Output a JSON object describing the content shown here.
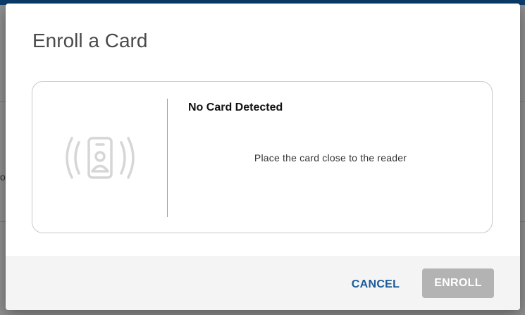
{
  "background": {
    "fragment_text": "o"
  },
  "dialog": {
    "title": "Enroll a Card",
    "status": {
      "title": "No Card Detected",
      "message": "Place the card close to the reader"
    },
    "buttons": {
      "cancel_label": "CANCEL",
      "enroll_label": "ENROLL"
    },
    "icon": "contactless-card-icon"
  },
  "colors": {
    "header_bar": "#0b3c6b",
    "cancel_text": "#1a5b9a",
    "enroll_disabled_bg": "#b3b3b3",
    "footer_bg": "#f4f4f4",
    "icon_gray": "#d6d6d6"
  }
}
